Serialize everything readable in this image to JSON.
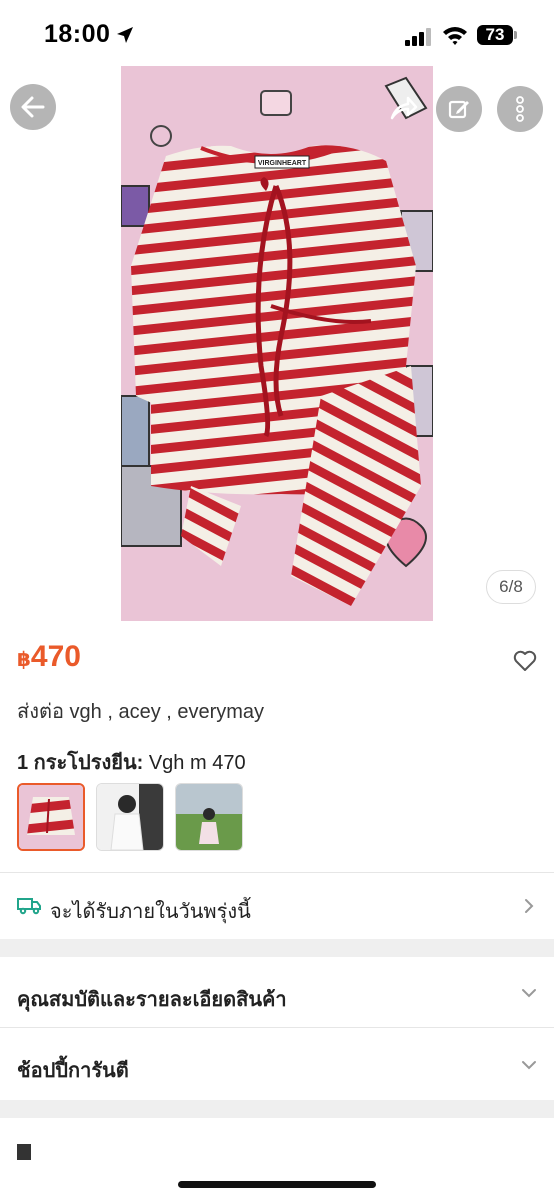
{
  "status_bar": {
    "time": "18:00",
    "battery": "73"
  },
  "gallery": {
    "counter": "6/8",
    "product_label": "VIRGINHEART"
  },
  "product": {
    "currency": "฿",
    "price": "470",
    "title": "ส่งต่อ vgh , acey , everymay",
    "variant_label": "1 กระโปรงยีน:",
    "variant_value": "Vgh m 470"
  },
  "delivery": {
    "text": "จะได้รับภายในวันพรุ่งนี้"
  },
  "sections": {
    "specs": "คุณสมบัติและรายละเอียดสินค้า",
    "guarantee": "ช้อปปี้การันตี"
  },
  "colors": {
    "accent": "#ea5a2a",
    "delivery_icon": "#21a58b"
  }
}
